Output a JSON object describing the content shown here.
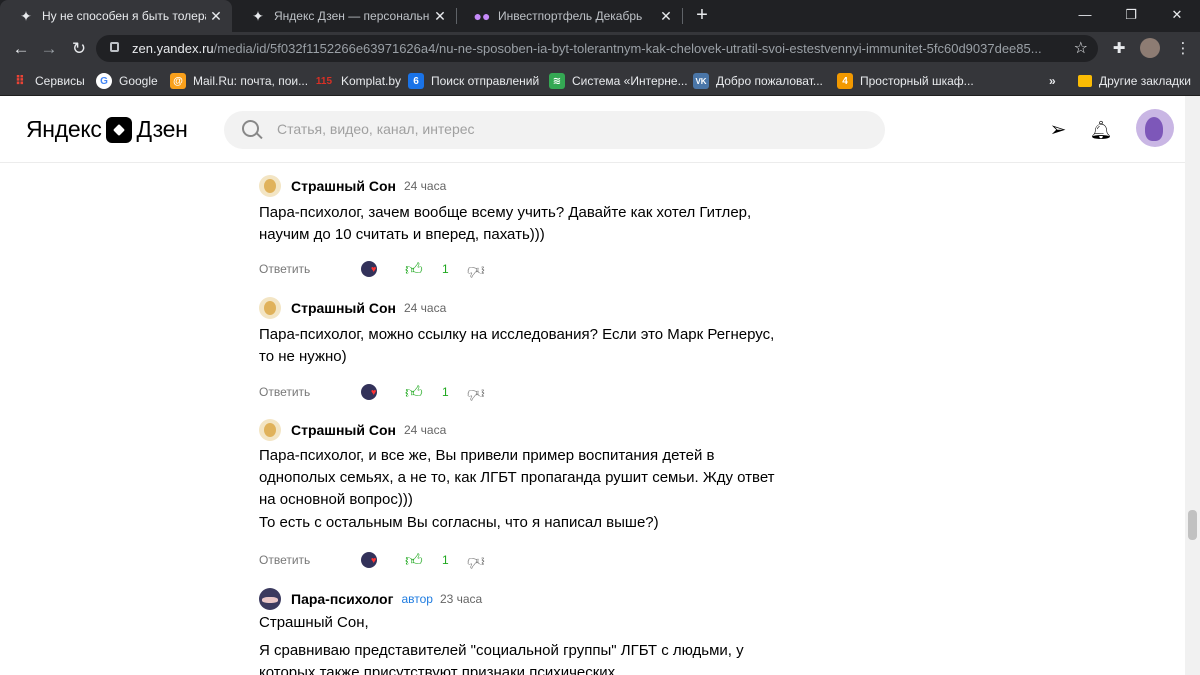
{
  "browser": {
    "tabs": [
      {
        "title": "Ну не способен я быть толеран",
        "active": true
      },
      {
        "title": "Яндекс Дзен — персональная л",
        "active": false
      },
      {
        "title": "Инвестпортфель Декабрь",
        "active": false
      }
    ],
    "url_host": "zen.yandex.ru",
    "url_path": "/media/id/5f032f1152266e63971626a4/nu-ne-sposoben-ia-byt-tolerantnym-kak-chelovek-utratil-svoi-estestvennyi-immunitet-5fc60d9037dee85...",
    "bookmarks": [
      {
        "label": "Сервисы",
        "icon": "apps-grid-icon",
        "color": "#ea4335"
      },
      {
        "label": "Google",
        "icon": "google-icon",
        "color": "#4285f4"
      },
      {
        "label": "Mail.Ru: почта, пои...",
        "icon": "mailru-icon",
        "color": "#f9a01b"
      },
      {
        "label": "Komplat.by",
        "icon": "komplat-icon",
        "color": "#d93025",
        "badge": "115"
      },
      {
        "label": "Поиск отправлений",
        "icon": "tracking-icon",
        "color": "#1a73e8"
      },
      {
        "label": "Система «Интерне...",
        "icon": "feed-icon",
        "color": "#34a853"
      },
      {
        "label": "Добро пожаловат...",
        "icon": "vk-icon",
        "color": "#4a76a8"
      },
      {
        "label": "Просторный шкаф...",
        "icon": "shop-icon",
        "color": "#f29900"
      }
    ],
    "other_bookmarks": "Другие закладки",
    "overflow": "»"
  },
  "header": {
    "logo_left": "Яндекс",
    "logo_right": "Дзен",
    "search_placeholder": "Статья, видео, канал, интерес"
  },
  "comments": [
    {
      "author": "Страшный Сон",
      "tag": "",
      "time": "24 часа",
      "paragraphs": [
        "Пара-психолог, зачем вообще всему учить? Давайте как хотел Гитлер, научим до 10 считать и вперед, пахать)))"
      ],
      "reply": "Ответить",
      "likes": "1"
    },
    {
      "author": "Страшный Сон",
      "tag": "",
      "time": "24 часа",
      "paragraphs": [
        "Пара-психолог, можно ссылку на исследования? Если это Марк Регнерус, то не нужно)"
      ],
      "reply": "Ответить",
      "likes": "1"
    },
    {
      "author": "Страшный Сон",
      "tag": "",
      "time": "24 часа",
      "paragraphs": [
        "Пара-психолог, и все же, Вы привели пример воспитания детей в однополых семьях, а не то, как ЛГБТ пропаганда рушит семьи. Жду ответ на основной вопрос)))",
        "То есть с остальным Вы согласны, что я написал выше?)"
      ],
      "reply": "Ответить",
      "likes": "1"
    },
    {
      "author": "Пара-психолог",
      "tag": "автор",
      "time": "23 часа",
      "paragraphs": [
        "Страшный Сон,",
        "Я сравниваю представителей \"социальной группы\" ЛГБТ с людьми, у которых также присутствуют признаки психических"
      ]
    }
  ]
}
